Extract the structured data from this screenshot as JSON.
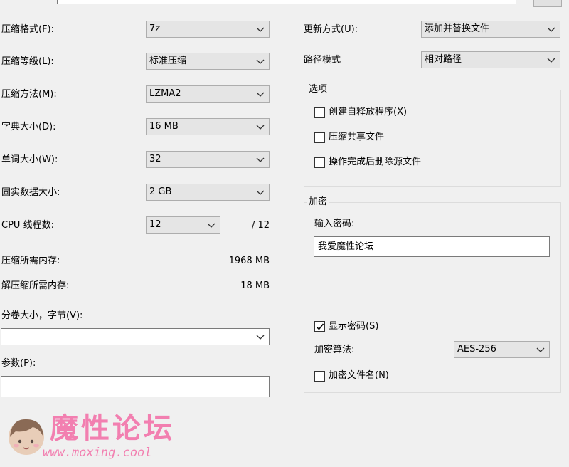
{
  "top": {
    "path_value": ""
  },
  "left": {
    "format_label": "压缩格式(F):",
    "format_value": "7z",
    "level_label": "压缩等级(L):",
    "level_value": "标准压缩",
    "method_label": "压缩方法(M):",
    "method_value": "LZMA2",
    "dict_label": "字典大小(D):",
    "dict_value": "16 MB",
    "word_label": "单词大小(W):",
    "word_value": "32",
    "solid_label": "固实数据大小:",
    "solid_value": "2 GB",
    "cpu_label": "CPU 线程数:",
    "cpu_value": "12",
    "cpu_total": "/ 12",
    "mem_compress_label": "压缩所需内存:",
    "mem_compress_value": "1968 MB",
    "mem_decompress_label": "解压缩所需内存:",
    "mem_decompress_value": "18 MB",
    "volume_label": "分卷大小，字节(V):",
    "volume_value": "",
    "params_label": "参数(P):",
    "params_value": ""
  },
  "right": {
    "update_label": "更新方式(U):",
    "update_value": "添加并替换文件",
    "path_mode_label": "路径模式",
    "path_mode_value": "相对路径",
    "options": {
      "title": "选项",
      "sfx_label": "创建自释放程序(X)",
      "sfx_checked": false,
      "shared_label": "压缩共享文件",
      "shared_checked": false,
      "delete_label": "操作完成后删除源文件",
      "delete_checked": false
    },
    "encryption": {
      "title": "加密",
      "password_label": "输入密码:",
      "password_value": "我爱魔性论坛",
      "show_password_label": "显示密码(S)",
      "show_password_checked": true,
      "method_label": "加密算法:",
      "method_value": "AES-256",
      "encrypt_names_label": "加密文件名(N)",
      "encrypt_names_checked": false
    }
  },
  "watermark": {
    "title": "魔性论坛",
    "url": "www.moxing.cool"
  },
  "colors": {
    "background": "#f0f0f0",
    "watermark": "#f27fb0"
  }
}
